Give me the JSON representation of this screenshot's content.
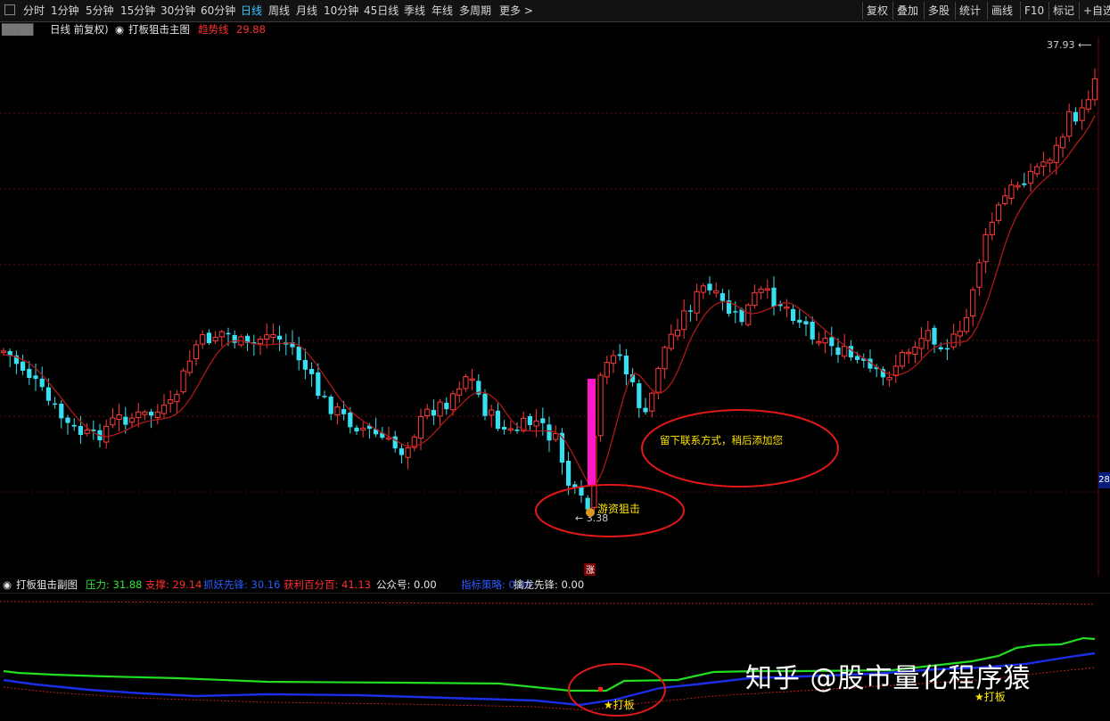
{
  "toolbar": {
    "periods": [
      "分时",
      "1分钟",
      "5分钟",
      "15分钟",
      "30分钟",
      "60分钟",
      "日线",
      "周线",
      "月线",
      "10分钟",
      "45日线",
      "季线",
      "年线",
      "多周期",
      "更多 >"
    ],
    "active_period": "日线",
    "right_buttons": [
      "复权",
      "叠加",
      "多股",
      "统计",
      "画线",
      "F10",
      "标记",
      "+自选"
    ]
  },
  "main_header": {
    "title": "日线 前复权)",
    "indicator_name": "打板狙击主图",
    "trend_label": "趋势线",
    "trend_value": "29.88"
  },
  "main_chart": {
    "max_label": "37.93",
    "min_label": "3.38",
    "signal_label": "游资狙击",
    "note_text": "留下联系方式，稍后添加您",
    "up_marker": "涨",
    "axis_tag": "28"
  },
  "sub_header": {
    "indicator_name": "打板狙击副图",
    "items": [
      {
        "label": "压力:",
        "value": "31.88",
        "color": "#32e632"
      },
      {
        "label": "支撑:",
        "value": "29.14",
        "color": "#ff3030"
      },
      {
        "label": "抓妖先锋:",
        "value": "30.16",
        "color": "#2d5bff"
      },
      {
        "label": "获利百分百:",
        "value": "41.13",
        "color": "#ff3030"
      },
      {
        "label": "公众号:",
        "value": "0.00",
        "color": "#e6e6e6"
      },
      {
        "label": "指标策略:",
        "value": "0.00",
        "color": "#2d5bff"
      },
      {
        "label": "擒龙先锋:",
        "value": "0.00",
        "color": "#e6e6e6"
      }
    ]
  },
  "sub_chart": {
    "signal_labels": [
      "★打板",
      "★打板"
    ]
  },
  "watermark": "知乎 @股市量化程序猿",
  "colors": {
    "up": "#ff3a3a",
    "down": "#36e0f0",
    "ma": "#b01818",
    "pressure": "#22dd22",
    "support_line": "#1a2ee8",
    "dotted": "#c02020",
    "magenta": "#ff18c8",
    "annotation": "#e01818"
  }
}
